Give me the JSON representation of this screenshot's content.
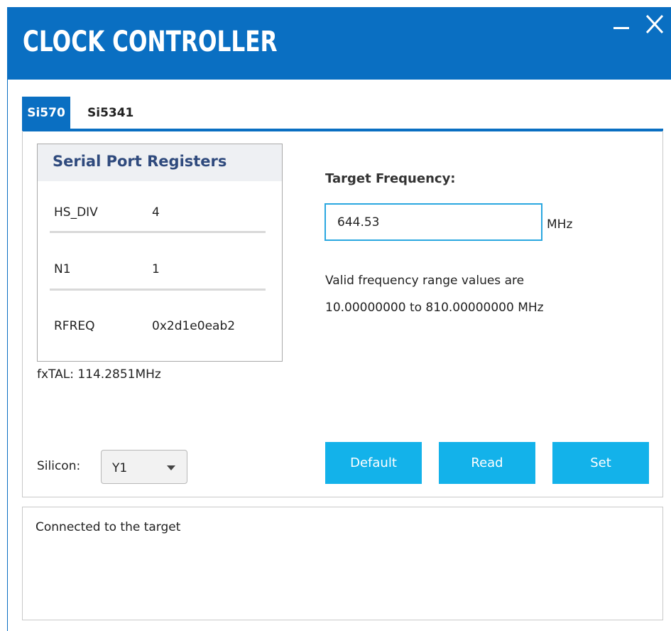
{
  "window": {
    "title": "CLOCK CONTROLLER",
    "accent_color": "#0a6fc2",
    "button_color": "#13b2ea"
  },
  "tabs": [
    {
      "label": "Si570",
      "active": true
    },
    {
      "label": "Si5341",
      "active": false
    }
  ],
  "registers": {
    "title": "Serial Port Registers",
    "rows": [
      {
        "name": "HS_DIV",
        "value": "4"
      },
      {
        "name": "N1",
        "value": "1"
      },
      {
        "name": "RFREQ",
        "value": "0x2d1e0eab2"
      }
    ]
  },
  "fxtal": "fxTAL: 114.2851MHz",
  "silicon": {
    "label": "Silicon:",
    "selected": "Y1"
  },
  "target_frequency": {
    "label": "Target Frequency:",
    "value": "644.53",
    "unit": "MHz",
    "valid_line1": "Valid frequency range values are",
    "valid_line2": "10.00000000 to 810.00000000 MHz"
  },
  "buttons": {
    "default": "Default",
    "read": "Read",
    "set": "Set"
  },
  "log": {
    "message": "Connected to the target"
  }
}
